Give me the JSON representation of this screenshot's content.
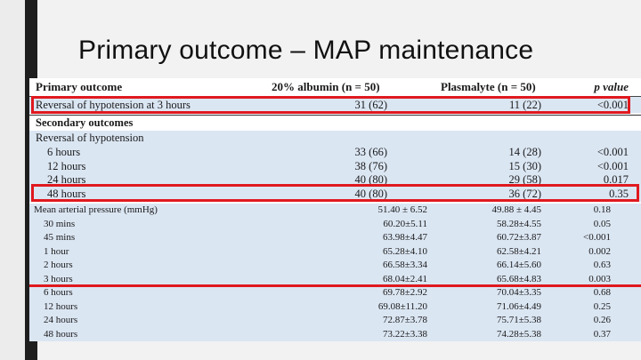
{
  "slide": {
    "title": "Primary outcome – MAP maintenance"
  },
  "table": {
    "header": {
      "col0": "Primary outcome",
      "col1": "20% albumin (n = 50)",
      "col2": "Plasmalyte (n = 50)",
      "col3": "p value"
    },
    "primary_row": {
      "label": "Reversal of hypotension at 3 hours",
      "albumin": "31 (62)",
      "plasmalyte": "11 (22)",
      "p": "<0.001"
    },
    "secondary_title": "Secondary outcomes",
    "reversal_title": "Reversal of hypotension",
    "reversal_rows": [
      {
        "label": "6 hours",
        "albumin": "33 (66)",
        "plasmalyte": "14 (28)",
        "p": "<0.001"
      },
      {
        "label": "12 hours",
        "albumin": "38 (76)",
        "plasmalyte": "15 (30)",
        "p": "<0.001"
      },
      {
        "label": "24 hours",
        "albumin": "40 (80)",
        "plasmalyte": "29 (58)",
        "p": "0.017"
      },
      {
        "label": "48 hours",
        "albumin": "40 (80)",
        "plasmalyte": "36 (72)",
        "p": "0.35"
      }
    ],
    "map_rows": [
      {
        "label": "Mean arterial pressure (mmHg)",
        "albumin": "51.40 ± 6.52",
        "plasmalyte": "49.88 ± 4.45",
        "p": "0.18"
      },
      {
        "label": "30 mins",
        "albumin": "60.20±5.11",
        "plasmalyte": "58.28±4.55",
        "p": "0.05"
      },
      {
        "label": "45 mins",
        "albumin": "63.98±4.47",
        "plasmalyte": "60.72±3.87",
        "p": "<0.001"
      },
      {
        "label": "1 hour",
        "albumin": "65.28±4.10",
        "plasmalyte": "62.58±4.21",
        "p": "0.002"
      },
      {
        "label": "2 hours",
        "albumin": "66.58±3.34",
        "plasmalyte": "66.14±5.60",
        "p": "0.63"
      },
      {
        "label": "3 hours",
        "albumin": "68.04±2.41",
        "plasmalyte": "65.68±4.83",
        "p": "0.003"
      },
      {
        "label": "6 hours",
        "albumin": "69.78±2.92",
        "plasmalyte": "70.04±3.35",
        "p": "0.68"
      },
      {
        "label": "12 hours",
        "albumin": "69.08±11.20",
        "plasmalyte": "71.06±4.49",
        "p": "0.25"
      },
      {
        "label": "24 hours",
        "albumin": "72.87±3.78",
        "plasmalyte": "75.71±5.38",
        "p": "0.26"
      },
      {
        "label": "48 hours",
        "albumin": "73.22±3.38",
        "plasmalyte": "74.28±5.38",
        "p": "0.37"
      }
    ]
  },
  "highlight_color": "#e0191f"
}
